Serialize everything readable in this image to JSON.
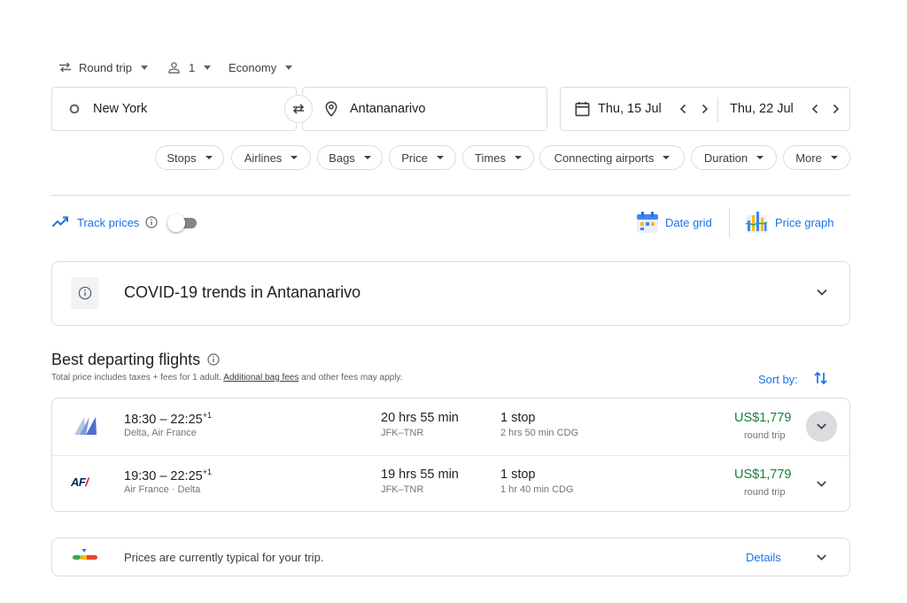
{
  "trip_options": {
    "trip_type": "Round trip",
    "passengers": "1",
    "cabin_class": "Economy"
  },
  "search": {
    "origin": "New York",
    "destination": "Antananarivo",
    "depart_date": "Thu, 15 Jul",
    "return_date": "Thu, 22 Jul"
  },
  "filters": [
    "Stops",
    "Airlines",
    "Bags",
    "Price",
    "Times",
    "Connecting airports",
    "Duration",
    "More"
  ],
  "tools": {
    "track_prices": "Track prices",
    "track_prices_on": false,
    "date_grid": "Date grid",
    "price_graph": "Price graph"
  },
  "covid": {
    "title": "COVID-19 trends in Antananarivo"
  },
  "results": {
    "heading": "Best departing flights",
    "note_prefix": "Total price includes taxes + fees for 1 adult. ",
    "note_link": "Additional bag fees",
    "note_suffix": " and other fees may apply.",
    "sort_label": "Sort by:",
    "flights": [
      {
        "depart": "18:30",
        "arrive": "22:25",
        "day_offset": "+1",
        "airlines": "Delta, Air France",
        "duration": "20 hrs 55 min",
        "route": "JFK–TNR",
        "stops": "1 stop",
        "layover": "2 hrs 50 min CDG",
        "price": "US$1,779",
        "price_note": "round trip",
        "logo": "delta-airfrance-logo"
      },
      {
        "depart": "19:30",
        "arrive": "22:25",
        "day_offset": "+1",
        "airlines": "Air France · Delta",
        "duration": "19 hrs 55 min",
        "route": "JFK–TNR",
        "stops": "1 stop",
        "layover": "1 hr 40 min CDG",
        "price": "US$1,779",
        "price_note": "round trip",
        "logo": "air-france-logo",
        "logo_text": "AF"
      }
    ]
  },
  "insight": {
    "text": "Prices are currently typical for your trip.",
    "details": "Details"
  },
  "colors": {
    "accent": "#1a73e8",
    "price_green": "#188038",
    "border": "#dadce0"
  }
}
